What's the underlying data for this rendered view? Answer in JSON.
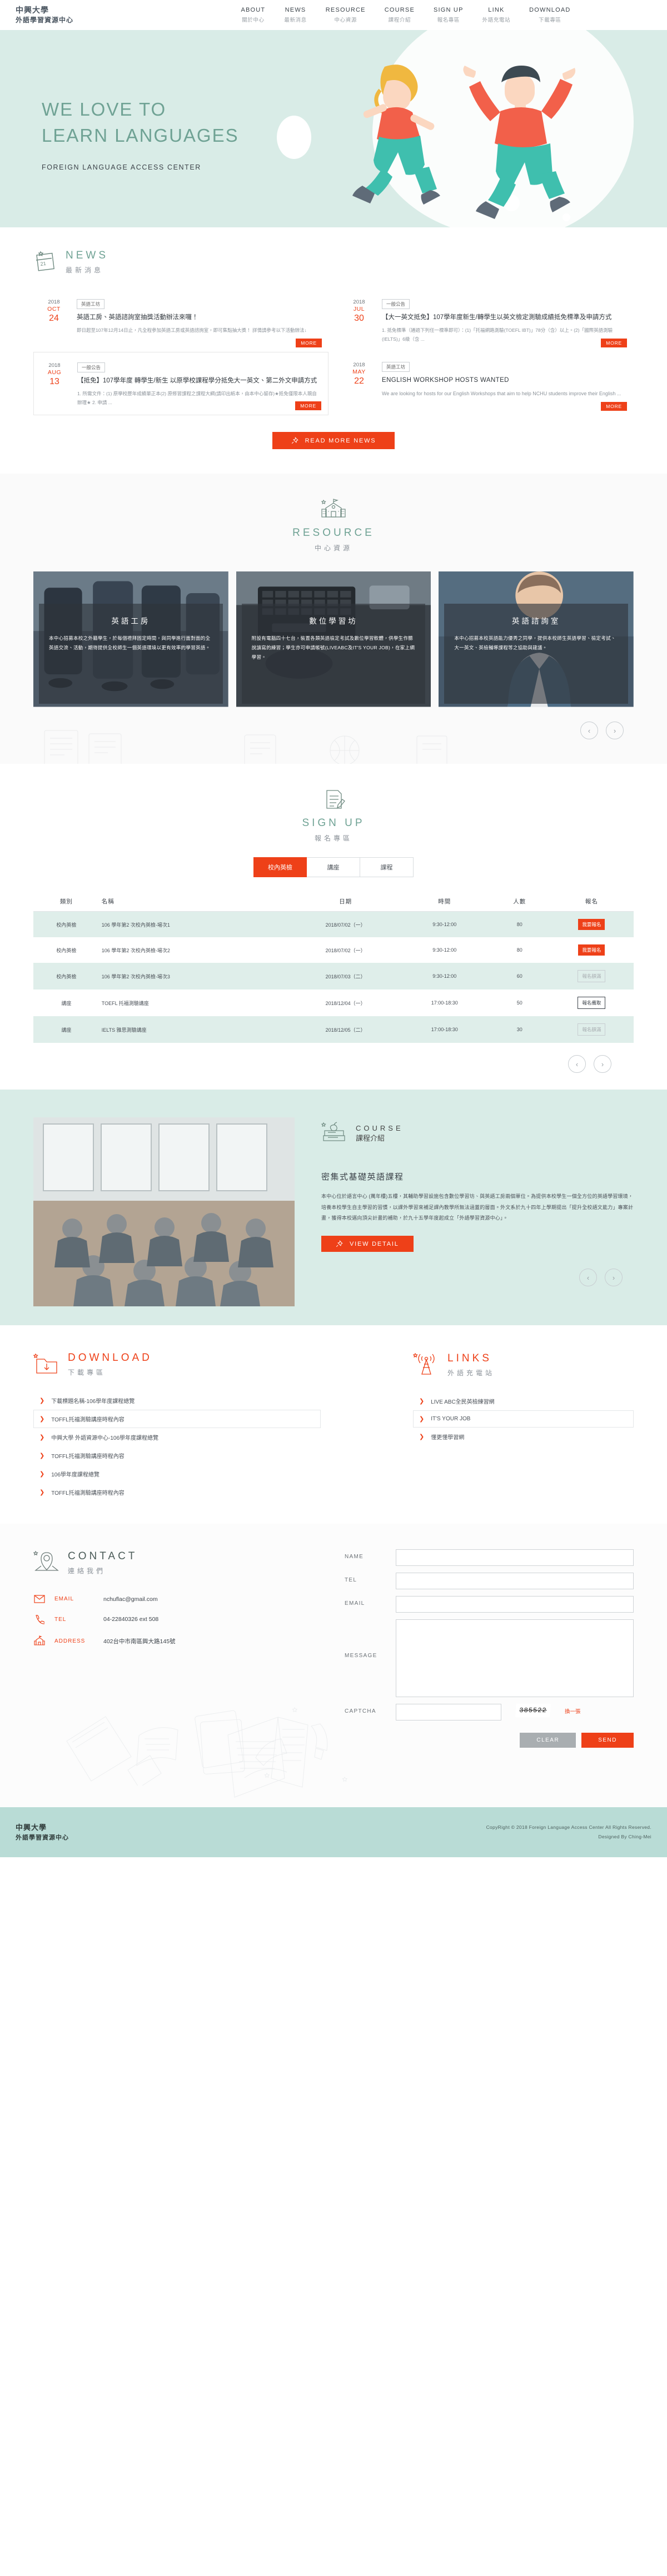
{
  "header": {
    "brand_line1": "中興大學",
    "brand_line2": "外語學習資源中心",
    "nav": [
      {
        "en": "ABOUT",
        "cn": "關於中心"
      },
      {
        "en": "NEWS",
        "cn": "最新消息"
      },
      {
        "en": "RESOURCE",
        "cn": "中心資源"
      },
      {
        "en": "COURSE",
        "cn": "課程介紹"
      },
      {
        "en": "SIGN UP",
        "cn": "報名專區"
      },
      {
        "en": "LINK",
        "cn": "外語充電站"
      },
      {
        "en": "DOWNLOAD",
        "cn": "下載專區"
      }
    ]
  },
  "hero": {
    "title_line1": "WE LOVE TO",
    "title_line2": "LEARN LANGUAGES",
    "subtitle": "FOREIGN LANGUAGE ACCESS CENTER"
  },
  "news": {
    "en": "NEWS",
    "cn": "最新消息",
    "read_more_label": "READ MORE NEWS",
    "more_label": "MORE",
    "items": [
      {
        "year": "2018",
        "month": "OCT",
        "day": "24",
        "tag": "英語工坊",
        "title": "英語工房、英語諮詢室抽獎活動辦法來囉！",
        "desc": "即日起至107年12月14日止，凡全程參加英語工房或英語諮詢室，即可集點抽大獎！ 詳情請參考以下活動辦法↓"
      },
      {
        "year": "2018",
        "month": "JUL",
        "day": "30",
        "tag": "一般公告",
        "title": "【大一英文抵免】107學年度新生/轉學生以英文檢定測驗成績抵免標準及申請方式",
        "desc": "1. 抵免標準（通過下列任一標準即可）：(1)「托福網路測驗(TOEFL IBT)」78分（含）以上。(2)「國際英語測驗(IELTS)」6級（含 ..."
      },
      {
        "year": "2018",
        "month": "AUG",
        "day": "13",
        "tag": "一般公告",
        "title": "【抵免】107學年度 轉學生/新生 以原學校課程學分抵免大一英文、第二外文申請方式",
        "desc": "1. 所需文件：(1) 原學校歷年成績單正本(2) 原修習課程之課程大綱(請印出紙本，由本中心留存)★抵免僅限本人親自辦理★ 2. 申請 ..."
      },
      {
        "year": "2018",
        "month": "MAY",
        "day": "22",
        "tag": "英語工坊",
        "title": "ENGLISH WORKSHOP HOSTS WANTED",
        "desc": "We are looking for hosts for our English Workshops that aim to help NCHU students improve their English ..."
      }
    ]
  },
  "resource": {
    "en": "RESOURCE",
    "cn": "中心資源",
    "cards": [
      {
        "title": "英語工房",
        "desc": "本中心招募本校之外籍學生，於每個禮拜固定時間，與同學進行面對面的全英語交流、活動，期待提供全校師生一個英語環境以更有效率的學習英語。"
      },
      {
        "title": "數位學習坊",
        "desc": "附設有電腦四十七台，裝置各類英語檢定考試及數位學習軟體，供學生作聽說讀寫的練習；學生亦可申請帳號(LIVEABC及IT'S YOUR JOB)，在家上網學習。"
      },
      {
        "title": "英語諮詢室",
        "desc": "本中心招募本校英語能力優秀之同學，提供本校師生英語學習、檢定考試、大一英文、英檢輔導課程等之協助與建議。"
      }
    ]
  },
  "signup": {
    "en": "SIGN UP",
    "cn": "報名專區",
    "tabs": [
      {
        "label": "校內英檢",
        "active": true
      },
      {
        "label": "講座",
        "active": false
      },
      {
        "label": "課程",
        "active": false
      }
    ],
    "columns": [
      "類別",
      "名稱",
      "日期",
      "時間",
      "人數",
      "報名"
    ],
    "rows": [
      {
        "cat": "校內英檢",
        "name": "106 學年第2 次校內英檢-場次1",
        "date": "2018/07/02（一）",
        "time": "9:30-12:00",
        "num": "80",
        "action": "我要報名",
        "state": "open"
      },
      {
        "cat": "校內英檢",
        "name": "106 學年第2 次校內英檢-場次2",
        "date": "2018/07/02（一）",
        "time": "9:30-12:00",
        "num": "80",
        "action": "我要報名",
        "state": "open"
      },
      {
        "cat": "校內英檢",
        "name": "106 學年第2 次校內英檢-場次3",
        "date": "2018/07/03（二）",
        "time": "9:30-12:00",
        "num": "60",
        "action": "報名額滿",
        "state": "full"
      },
      {
        "cat": "講座",
        "name": "TOEFL 托福測驗講座",
        "date": "2018/12/04（一）",
        "time": "17:00-18:30",
        "num": "50",
        "action": "報名備取",
        "state": "wait"
      },
      {
        "cat": "講座",
        "name": "IELTS 雅思測驗講座",
        "date": "2018/12/05（二）",
        "time": "17:00-18:30",
        "num": "30",
        "action": "報名額滿",
        "state": "full"
      }
    ]
  },
  "course": {
    "en": "COURSE",
    "cn": "課程介紹",
    "title": "密集式基礎英語課程",
    "text": "本中心位於語言中心 (萬年樓)五樓，其輔助學習設施包含數位學習坊、與英語工房兩個單位。為提供本校學生一個全方位的英語學習環境，培養本校學生自主學習的習慣，以課外學習來補足課內教學所無法涵蓋的層面。外文系於九十四年上學期提出「提升全校語文能力」專案計畫，獲得本校邁向頂尖計畫的補助，於九十五學年度起成立「外語學習資源中心」。",
    "button_label": "VIEW DETAIL"
  },
  "download": {
    "en": "DOWNLOAD",
    "cn": "下載專區",
    "items": [
      {
        "label": "下載標題名稱-106學年度課程總覽",
        "highlight": false
      },
      {
        "label": "TOFFL托福測驗講座時程內容",
        "highlight": true
      },
      {
        "label": "中興大學 外語資源中心-106學年度課程總覽",
        "highlight": false
      },
      {
        "label": "TOFFL托福測驗講座時程內容",
        "highlight": false
      },
      {
        "label": "106學年度課程總覽",
        "highlight": false
      },
      {
        "label": "TOFFL托福測驗講座時程內容",
        "highlight": false
      }
    ]
  },
  "links": {
    "en": "LINKS",
    "cn": "外語充電站",
    "items": [
      {
        "label": "LIVE ABC全民英檢練習網",
        "highlight": false
      },
      {
        "label": "IT'S YOUR JOB",
        "highlight": true
      },
      {
        "label": "懂更懂學習網",
        "highlight": false
      }
    ]
  },
  "contact": {
    "en": "CONTACT",
    "cn": "連絡我們",
    "info": [
      {
        "icon": "envelope-icon",
        "label": "EMAIL",
        "value": "nchuflac@gmail.com"
      },
      {
        "icon": "phone-icon",
        "label": "TEL",
        "value": "04-22840326 ext 508"
      },
      {
        "icon": "school-icon",
        "label": "ADDRESS",
        "value": "402台中市南區興大路145號"
      }
    ],
    "form": {
      "name_label": "NAME",
      "name_value": "",
      "name_placeholder": "",
      "tel_label": "TEL",
      "tel_value": "",
      "tel_placeholder": "",
      "email_label": "EMAIL",
      "email_value": "",
      "email_placeholder": "",
      "message_label": "MESSAGE",
      "message_value": "",
      "message_placeholder": "",
      "captcha_label": "CAPTCHA",
      "captcha_value": "",
      "captcha_placeholder": "",
      "captcha_code": "385522",
      "captcha_refresh_label": "換一張",
      "clear_label": "CLEAR",
      "send_label": "SEND"
    }
  },
  "footer": {
    "brand_line1": "中興大學",
    "brand_line2": "外語學習資源中心",
    "copyright": "CopyRight © 2018 Foreign Language Access Center All Rights Reserved.",
    "designed": "Designed By Ching-Mei"
  },
  "colors": {
    "accent_red": "#ee4018",
    "accent_green": "#6fa294",
    "hero_bg": "#d9ece7",
    "footer_bg": "#b9dcd6"
  }
}
